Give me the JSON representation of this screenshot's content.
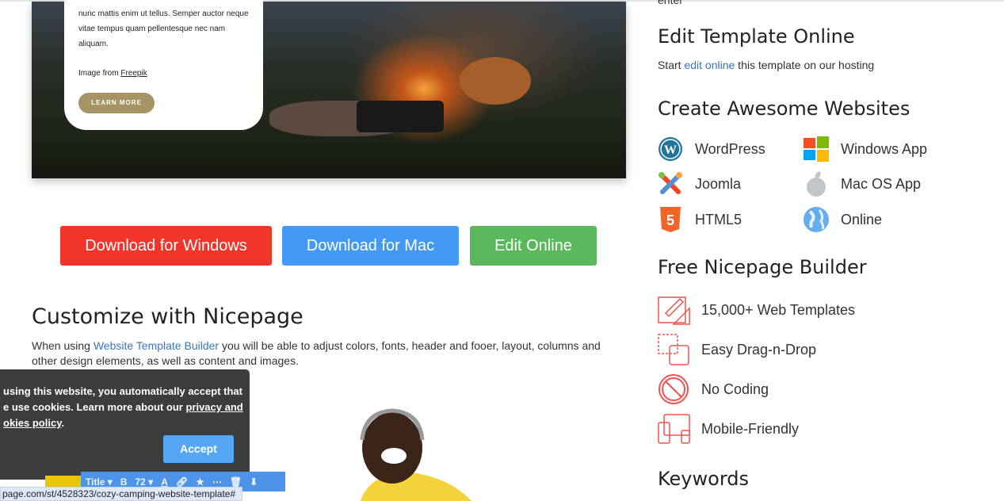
{
  "hero": {
    "card_text": "nunc mattis enim ut tellus. Semper auctor neque vitae tempus quam pellentesque nec nam aliquam.",
    "image_from": "Image from ",
    "freepik": "Freepik",
    "learn_more": "LEARN MORE"
  },
  "downloads": [
    {
      "label": "Download for Windows",
      "color": "#f2352b"
    },
    {
      "label": "Download for Mac",
      "color": "#4499f5"
    },
    {
      "label": "Edit Online",
      "color": "#5cb85c"
    }
  ],
  "customize": {
    "title": "Customize with Nicepage",
    "text_before": "When using ",
    "link": "Website Template Builder",
    "text_after": " you will be able to adjust colors, fonts, header and fooer, layout, columns and other design elements, as well as content and images."
  },
  "cookie": {
    "text1": "using this website, you automatically accept that e use cookies. Learn more about our ",
    "link": "privacy and okies policy",
    "text2": ".",
    "accept": "Accept"
  },
  "toolbar": {
    "style": "Title ▾",
    "bold": "B",
    "size": "72 ▾",
    "color": "A"
  },
  "status_url": "page.com/st/4528323/cozy-camping-website-template#",
  "sidebar": {
    "top_fragment": "enter",
    "edit_title": "Edit Template Online",
    "edit_start": "Start ",
    "edit_link": "edit online",
    "edit_rest": " this template on our hosting",
    "create_title": "Create Awesome Websites",
    "platforms": [
      {
        "label": "WordPress",
        "icon": "wordpress-icon"
      },
      {
        "label": "Windows App",
        "icon": "windows-icon"
      },
      {
        "label": "Joomla",
        "icon": "joomla-icon"
      },
      {
        "label": "Mac OS App",
        "icon": "apple-icon"
      },
      {
        "label": "HTML5",
        "icon": "html5-icon"
      },
      {
        "label": "Online",
        "icon": "globe-icon"
      }
    ],
    "free_title": "Free Nicepage Builder",
    "features": [
      {
        "label": "15,000+ Web Templates",
        "icon": "template-design-icon"
      },
      {
        "label": "Easy Drag-n-Drop",
        "icon": "drag-drop-icon"
      },
      {
        "label": "No Coding",
        "icon": "no-coding-icon"
      },
      {
        "label": "Mobile-Friendly",
        "icon": "devices-icon"
      }
    ],
    "keywords_title": "Keywords"
  },
  "colors": {
    "accent_link": "#3a76b9",
    "feature_icon": "#ef5350"
  }
}
